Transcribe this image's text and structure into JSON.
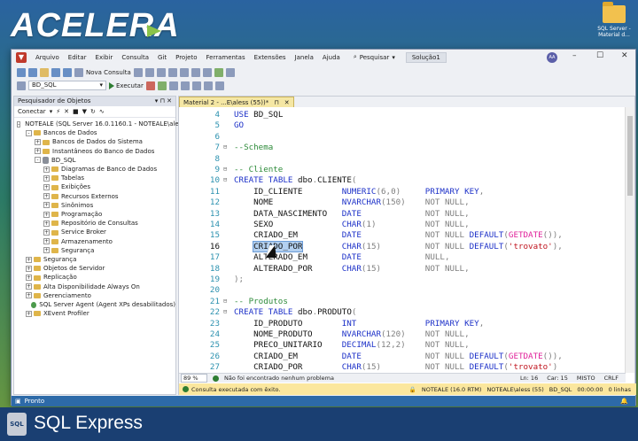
{
  "brand_top": "ACELERA",
  "desktop_icon_label": "SQL Server - Material d...",
  "menu": [
    "Arquivo",
    "Editar",
    "Exibir",
    "Consulta",
    "Git",
    "Projeto",
    "Ferramentas",
    "Extensões",
    "Janela",
    "Ajuda"
  ],
  "search_label": "Pesquisar",
  "solution": "Solução1",
  "avatar": "AA",
  "toolbar": {
    "new_query": "Nova Consulta",
    "database": "BD_SQL",
    "execute": "Executar"
  },
  "object_explorer": {
    "title": "Pesquisador de Objetos",
    "connect": "Conectar",
    "tree": [
      {
        "label": "NOTEALE (SQL Server 16.0.1160.1 - NOTEALE\\aless)",
        "depth": 0,
        "exp": "-",
        "icon": "server"
      },
      {
        "label": "Bancos de Dados",
        "depth": 1,
        "exp": "-",
        "icon": "folder"
      },
      {
        "label": "Bancos de Dados do Sistema",
        "depth": 2,
        "exp": "+",
        "icon": "folder"
      },
      {
        "label": "Instantâneos do Banco de Dados",
        "depth": 2,
        "exp": "+",
        "icon": "folder"
      },
      {
        "label": "BD_SQL",
        "depth": 2,
        "exp": "-",
        "icon": "db"
      },
      {
        "label": "Diagramas de Banco de Dados",
        "depth": 3,
        "exp": "+",
        "icon": "folder"
      },
      {
        "label": "Tabelas",
        "depth": 3,
        "exp": "+",
        "icon": "folder"
      },
      {
        "label": "Exibições",
        "depth": 3,
        "exp": "+",
        "icon": "folder"
      },
      {
        "label": "Recursos Externos",
        "depth": 3,
        "exp": "+",
        "icon": "folder"
      },
      {
        "label": "Sinônimos",
        "depth": 3,
        "exp": "+",
        "icon": "folder"
      },
      {
        "label": "Programação",
        "depth": 3,
        "exp": "+",
        "icon": "folder"
      },
      {
        "label": "Repositório de Consultas",
        "depth": 3,
        "exp": "+",
        "icon": "folder"
      },
      {
        "label": "Service Broker",
        "depth": 3,
        "exp": "+",
        "icon": "folder"
      },
      {
        "label": "Armazenamento",
        "depth": 3,
        "exp": "+",
        "icon": "folder"
      },
      {
        "label": "Segurança",
        "depth": 3,
        "exp": "+",
        "icon": "folder"
      },
      {
        "label": "Segurança",
        "depth": 1,
        "exp": "+",
        "icon": "folder"
      },
      {
        "label": "Objetos de Servidor",
        "depth": 1,
        "exp": "+",
        "icon": "folder"
      },
      {
        "label": "Replicação",
        "depth": 1,
        "exp": "+",
        "icon": "folder"
      },
      {
        "label": "Alta Disponibilidade Always On",
        "depth": 1,
        "exp": "+",
        "icon": "folder"
      },
      {
        "label": "Gerenciamento",
        "depth": 1,
        "exp": "+",
        "icon": "folder"
      },
      {
        "label": "SQL Server Agent (Agent XPs desabilitados)",
        "depth": 1,
        "exp": "",
        "icon": "agent"
      },
      {
        "label": "XEvent Profiler",
        "depth": 1,
        "exp": "+",
        "icon": "folder"
      }
    ]
  },
  "editor": {
    "tab_title": "Material 2 - ...E\\aless (55))*",
    "lines": [
      {
        "n": "4",
        "t": "USE BD_SQL"
      },
      {
        "n": "5",
        "t": "GO"
      },
      {
        "n": "6",
        "t": ""
      },
      {
        "n": "7",
        "t": "--Schema",
        "fold": "-"
      },
      {
        "n": "8",
        "t": ""
      },
      {
        "n": "9",
        "t": "-- Cliente",
        "fold": "-"
      },
      {
        "n": "10",
        "t": "CREATE TABLE dbo.CLIENTE(",
        "fold": "-"
      },
      {
        "n": "11",
        "t": "    ID_CLIENTE        NUMERIC(6,0)     PRIMARY KEY,"
      },
      {
        "n": "12",
        "t": "    NOME              NVARCHAR(150)    NOT NULL,"
      },
      {
        "n": "13",
        "t": "    DATA_NASCIMENTO   DATE             NOT NULL,"
      },
      {
        "n": "14",
        "t": "    SEXO              CHAR(1)          NOT NULL,"
      },
      {
        "n": "15",
        "t": "    CRIADO_EM         DATE             NOT NULL DEFAULT(GETDATE()),"
      },
      {
        "n": "16",
        "t": "    CRIADO_POR        CHAR(15)         NOT NULL DEFAULT('trovato'),"
      },
      {
        "n": "17",
        "t": "    ALTERADO_EM       DATE             NULL,"
      },
      {
        "n": "18",
        "t": "    ALTERADO_POR      CHAR(15)         NOT NULL,"
      },
      {
        "n": "19",
        "t": ");"
      },
      {
        "n": "20",
        "t": ""
      },
      {
        "n": "21",
        "t": "-- Produtos",
        "fold": "-"
      },
      {
        "n": "22",
        "t": "CREATE TABLE dbo.PRODUTO(",
        "fold": "-"
      },
      {
        "n": "23",
        "t": "    ID_PRODUTO        INT              PRIMARY KEY,"
      },
      {
        "n": "24",
        "t": "    NOME_PRODUTO      NVARCHAR(120)    NOT NULL,"
      },
      {
        "n": "25",
        "t": "    PRECO_UNITARIO    DECIMAL(12,2)    NOT NULL,"
      },
      {
        "n": "26",
        "t": "    CRIADO_EM         DATE             NOT NULL DEFAULT(GETDATE()),"
      },
      {
        "n": "27",
        "t": "    CRIADO_POR        CHAR(15)         NOT NULL DEFAULT('trovato')"
      }
    ],
    "current_line": "16",
    "selected_word": "CRIADO_POR"
  },
  "editor_status": {
    "zoom": "89 %",
    "problems": "Não foi encontrado nenhum problema",
    "ln": "Ln: 16",
    "car": "Car: 15",
    "misto": "MISTO",
    "crlf": "CRLF"
  },
  "query_status": {
    "msg": "Consulta executada com êxito.",
    "server": "NOTEALE (16.0 RTM)",
    "user": "NOTEALE\\aless (55)",
    "db": "BD_SQL",
    "time": "00:00:00",
    "rows": "0 linhas"
  },
  "app_status": "Pronto",
  "brand_bottom": "SQL Express",
  "brand_icon": "SQL"
}
